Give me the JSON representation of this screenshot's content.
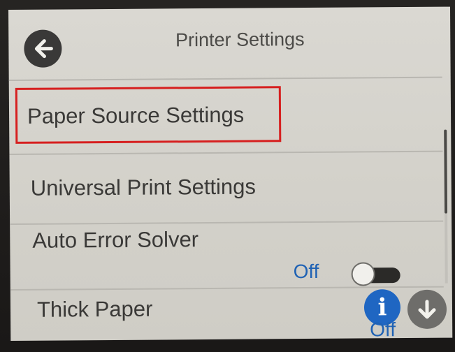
{
  "header": {
    "title": "Printer Settings",
    "back_icon": "arrow-left-icon"
  },
  "menu": {
    "items": [
      {
        "label": "Paper Source Settings",
        "highlighted": true
      },
      {
        "label": "Universal Print Settings"
      },
      {
        "label": "Auto Error Solver",
        "value": "Off",
        "toggle": "off"
      },
      {
        "label": "Thick Paper",
        "value": "Off",
        "info_icon": "info-icon"
      }
    ]
  },
  "controls": {
    "info_glyph": "i",
    "scroll_down_icon": "arrow-down-icon"
  },
  "colors": {
    "screen_bg": "#d6d4ce",
    "highlight": "#d61f1f",
    "accent_blue": "#1f66c2",
    "text": "#3a3937"
  }
}
